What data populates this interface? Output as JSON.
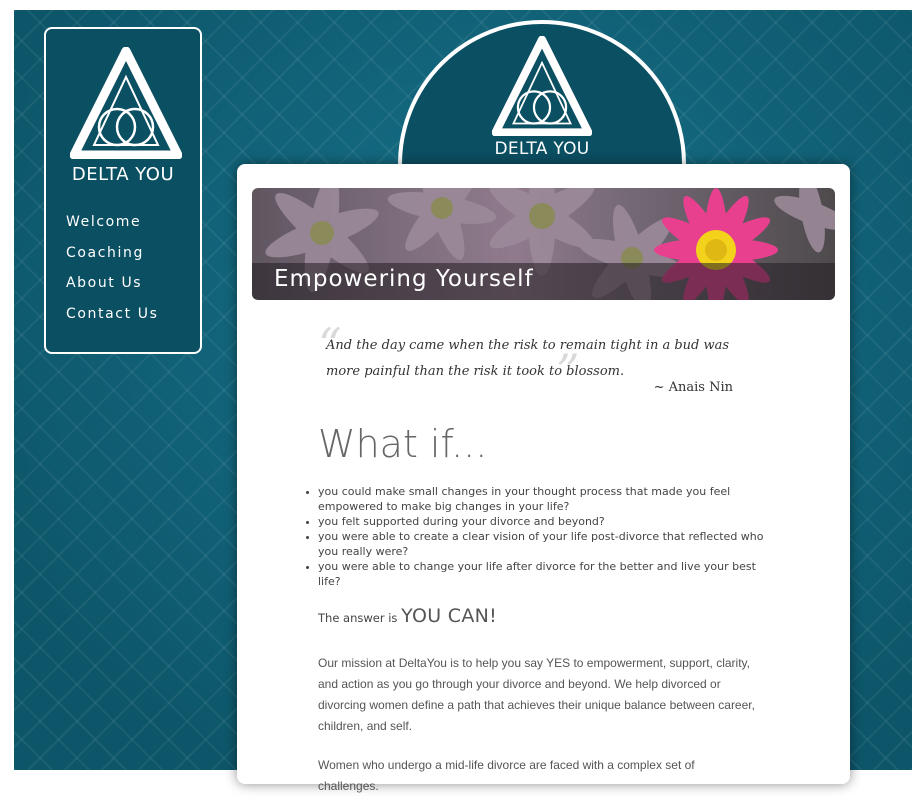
{
  "brand": {
    "name": "DELTA YOU"
  },
  "nav": {
    "items": [
      {
        "label": "Welcome"
      },
      {
        "label": "Coaching"
      },
      {
        "label": "About Us"
      },
      {
        "label": "Contact Us"
      }
    ]
  },
  "banner": {
    "title": "Empowering Yourself"
  },
  "quote": {
    "open_mark": "“",
    "close_mark": "”",
    "text": "And the day came when the risk to remain tight in a bud was more painful than the risk it took to blossom.",
    "author": "~ Anais Nin"
  },
  "main": {
    "heading": "What if...",
    "bullets": [
      "you could make small changes in your thought process that made you feel empowered to make big changes in your life?",
      "you felt supported during your divorce and beyond?",
      "you were able to create a clear vision of your life post-divorce that reflected who you really were?",
      "you were able to change your life after divorce for the better and live your best life?"
    ],
    "answer_prefix": "The answer is",
    "answer_emphasis": "YOU CAN!",
    "paragraph1": "Our mission at DeltaYou is to help you say YES to empowerment, support, clarity, and action as you go through your divorce and beyond.  We help divorced or divorcing women define a path that achieves their unique balance between career, children, and self.",
    "paragraph2": "Women who undergo a mid-life divorce are faced with a complex set of challenges."
  },
  "colors": {
    "background_teal": "#0f5f73",
    "panel": "#ffffff",
    "accent_pink": "#e8408e",
    "flower_center": "#f2d21a"
  }
}
